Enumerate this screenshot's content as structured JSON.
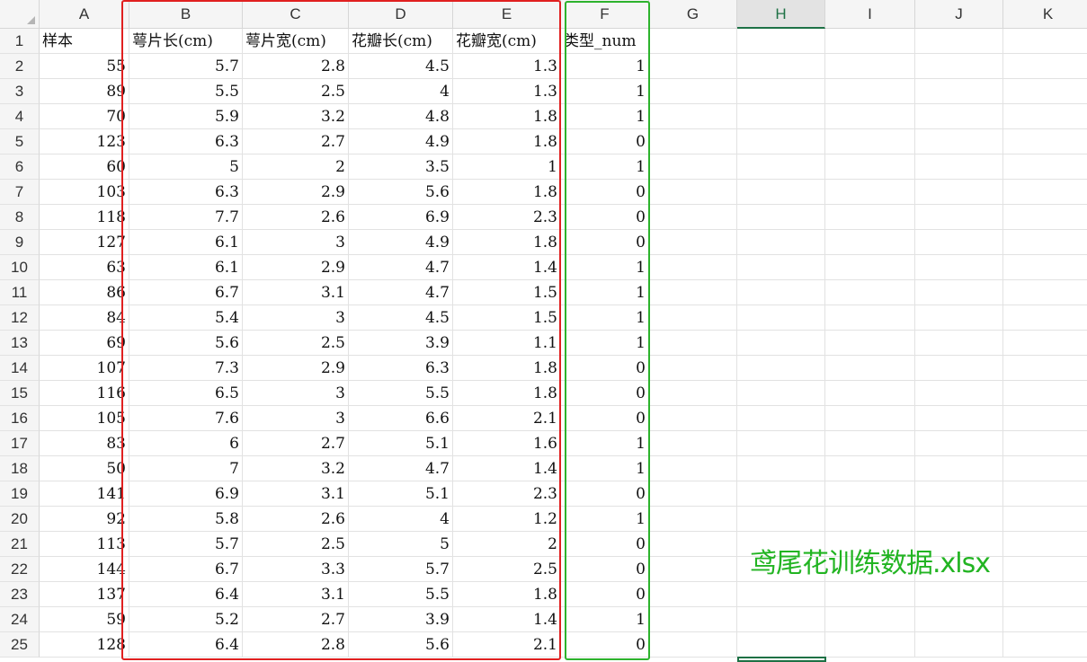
{
  "sheet": {
    "columns": [
      "A",
      "B",
      "C",
      "D",
      "E",
      "F",
      "G",
      "H",
      "I",
      "J",
      "K"
    ],
    "selected_column": "H",
    "rows": [
      [
        "样本",
        "萼片长(cm)",
        "萼片宽(cm)",
        "花瓣长(cm)",
        "花瓣宽(cm)",
        "类型_num"
      ],
      [
        "55",
        "5.7",
        "2.8",
        "4.5",
        "1.3",
        "1"
      ],
      [
        "89",
        "5.5",
        "2.5",
        "4",
        "1.3",
        "1"
      ],
      [
        "70",
        "5.9",
        "3.2",
        "4.8",
        "1.8",
        "1"
      ],
      [
        "123",
        "6.3",
        "2.7",
        "4.9",
        "1.8",
        "0"
      ],
      [
        "60",
        "5",
        "2",
        "3.5",
        "1",
        "1"
      ],
      [
        "103",
        "6.3",
        "2.9",
        "5.6",
        "1.8",
        "0"
      ],
      [
        "118",
        "7.7",
        "2.6",
        "6.9",
        "2.3",
        "0"
      ],
      [
        "127",
        "6.1",
        "3",
        "4.9",
        "1.8",
        "0"
      ],
      [
        "63",
        "6.1",
        "2.9",
        "4.7",
        "1.4",
        "1"
      ],
      [
        "86",
        "6.7",
        "3.1",
        "4.7",
        "1.5",
        "1"
      ],
      [
        "84",
        "5.4",
        "3",
        "4.5",
        "1.5",
        "1"
      ],
      [
        "69",
        "5.6",
        "2.5",
        "3.9",
        "1.1",
        "1"
      ],
      [
        "107",
        "7.3",
        "2.9",
        "6.3",
        "1.8",
        "0"
      ],
      [
        "116",
        "6.5",
        "3",
        "5.5",
        "1.8",
        "0"
      ],
      [
        "105",
        "7.6",
        "3",
        "6.6",
        "2.1",
        "0"
      ],
      [
        "83",
        "6",
        "2.7",
        "5.1",
        "1.6",
        "1"
      ],
      [
        "50",
        "7",
        "3.2",
        "4.7",
        "1.4",
        "1"
      ],
      [
        "141",
        "6.9",
        "3.1",
        "5.1",
        "2.3",
        "0"
      ],
      [
        "92",
        "5.8",
        "2.6",
        "4",
        "1.2",
        "1"
      ],
      [
        "113",
        "5.7",
        "2.5",
        "5",
        "2",
        "0"
      ],
      [
        "144",
        "6.7",
        "3.3",
        "5.7",
        "2.5",
        "0"
      ],
      [
        "137",
        "6.4",
        "3.1",
        "5.5",
        "1.8",
        "0"
      ],
      [
        "59",
        "5.2",
        "2.7",
        "3.9",
        "1.4",
        "1"
      ],
      [
        "128",
        "6.4",
        "2.8",
        "5.6",
        "2.1",
        "0"
      ]
    ]
  },
  "annotation": {
    "caption": "鸢尾花训练数据.xlsx",
    "feature_box_color": "#e02020",
    "label_box_color": "#2db32d",
    "caption_color": "#22b422"
  }
}
